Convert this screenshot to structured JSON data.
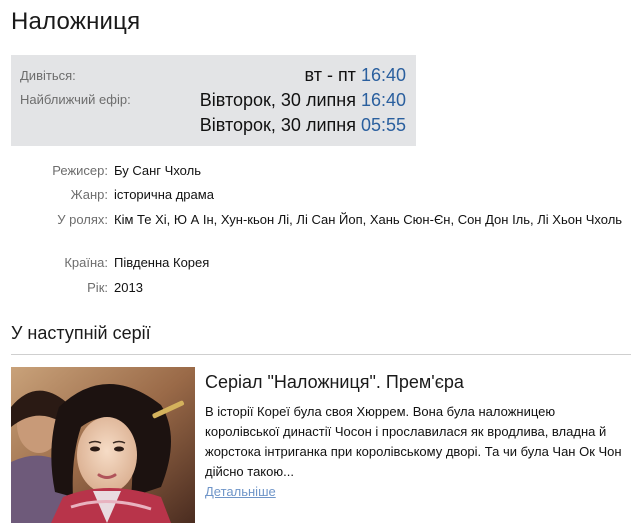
{
  "title": "Наложниця",
  "schedule": {
    "watch_label": "Дивіться:",
    "watch_days": "вт - пт",
    "watch_time": "16:40",
    "nearest_label": "Найближчий ефір:",
    "airings": [
      {
        "day": "Вівторок, 30 липня",
        "time": "16:40"
      },
      {
        "day": "Вівторок, 30 липня",
        "time": "05:55"
      }
    ]
  },
  "details": {
    "director_label": "Режисер:",
    "director": "Бу Санг Чхоль",
    "genre_label": "Жанр:",
    "genre": "історична драма",
    "cast_label": "У ролях:",
    "cast": "Кім Те Хі, Ю А Ін, Хун-кьон Лі, Лі Сан Йоп, Хань Сюн-Єн, Сон Дон Іль, Лі Хьон Чхоль",
    "country_label": "Країна:",
    "country": "Південна Корея",
    "year_label": "Рік:",
    "year": "2013"
  },
  "next_episode": {
    "section_title": "У наступній серії",
    "headline": "Серіал \"Наложниця\". Прем'єра",
    "text": "В історії Кореї була своя Хюррем. Вона була наложницею королівської династії Чосон і прославилася як вродлива, владна й жорстока інтриганка при королівському дворі. Та чи була Чан Ок Чон дійсно такою...",
    "more_link": "Детальніше"
  },
  "colors": {
    "accent_time": "#2a5f9e",
    "link": "#6f95c8",
    "schedule_bg": "#e3e4e6"
  }
}
